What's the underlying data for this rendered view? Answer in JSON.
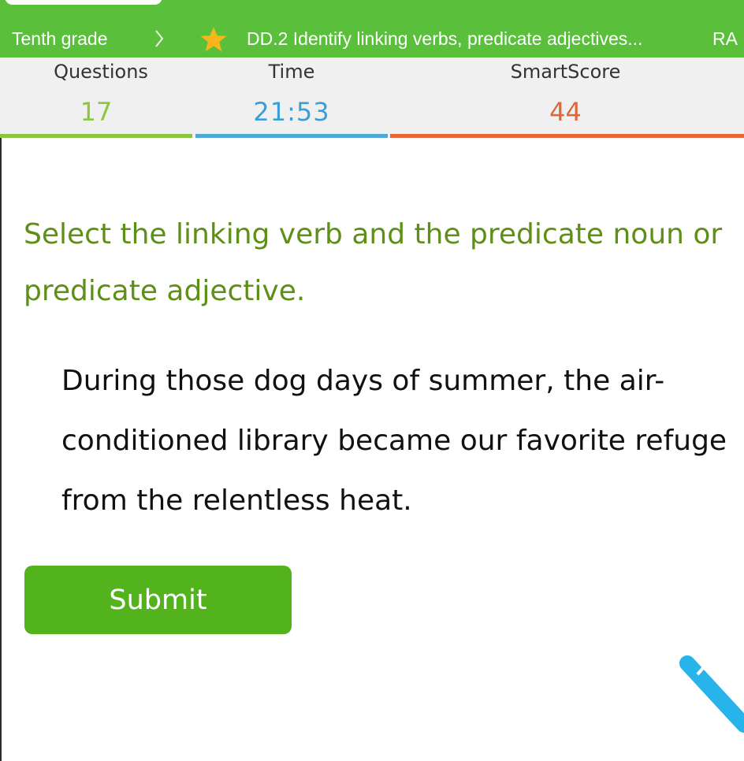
{
  "breadcrumb": {
    "grade": "Tenth grade",
    "skill": "DD.2 Identify linking verbs, predicate adjectives...",
    "extra": "RA"
  },
  "stats": {
    "questions_label": "Questions",
    "questions_value": "17",
    "time_label": "Time",
    "time_value": "21:53",
    "smartscore_label": "SmartScore",
    "smartscore_value": "44"
  },
  "question": {
    "instruction": "Select the linking verb and the predicate noun or predicate adjective.",
    "sentence_words": [
      "During",
      "those",
      "dog",
      "days",
      "of",
      "summer,",
      "the",
      "air-conditioned",
      "library",
      "became",
      "our",
      "favorite",
      "refuge",
      "from",
      "the",
      "relentless",
      "heat."
    ]
  },
  "actions": {
    "submit_label": "Submit"
  },
  "colors": {
    "header_green": "#5ac03c",
    "questions_green": "#8cc63f",
    "time_blue": "#3c9ed6",
    "smartscore_orange": "#e0663a",
    "instruction_green": "#5e8f17",
    "submit_green": "#53b31c",
    "pencil_blue": "#27b4ea"
  },
  "icons": {
    "breadcrumb_separator": "chevron-right-icon",
    "skill_badge": "star-icon",
    "scratchpad": "pencil-icon"
  }
}
